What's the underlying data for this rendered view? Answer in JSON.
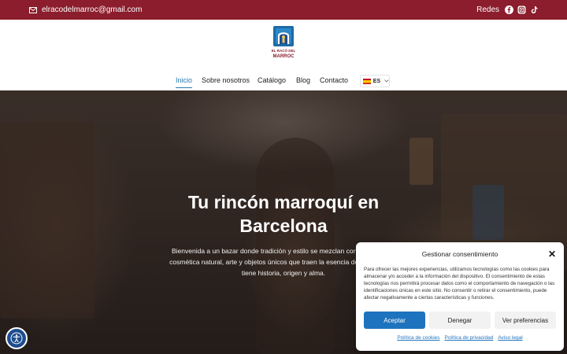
{
  "topbar": {
    "email": "elracodelmarroc@gmail.com",
    "social_label": "Redes",
    "icons": [
      "facebook-icon",
      "instagram-icon",
      "tiktok-icon"
    ],
    "bg_color": "#8b1d2c"
  },
  "header": {
    "logo_text_top": "EL RACÓ DEL",
    "logo_text_bottom": "MARROC",
    "nav": [
      {
        "label": "Inicio",
        "active": true
      },
      {
        "label": "Sobre nosotros",
        "active": false
      },
      {
        "label": "Catálogo",
        "active": false
      },
      {
        "label": "Blog",
        "active": false
      },
      {
        "label": "Contacto",
        "active": false
      }
    ],
    "language": "ES"
  },
  "hero": {
    "title_line1": "Tu rincón marroquí en",
    "title_line2": "Barcelona",
    "text_line1": "Bienvenida a un bazar donde tradición y estilo se mezclan con mucho color",
    "text_line2": "cosmética natural, arte y objetos únicos que traen la esencia de Marruecos a",
    "text_line3": "tiene historia, origen y alma."
  },
  "consent": {
    "title": "Gestionar consentimiento",
    "body": "Para ofrecer las mejores experiencias, utilizamos tecnologías como las cookies para almacenar y/o acceder a la información del dispositivo. El consentimiento de estas tecnologías nos permitirá procesar datos como el comportamiento de navegación o las identificaciones únicas en este sitio. No consentir o retirar el consentimiento, puede afectar negativamente a ciertas características y funciones.",
    "accept": "Aceptar",
    "deny": "Denegar",
    "preferences": "Ver preferencias",
    "links": [
      "Política de cookies",
      "Política de privacidad",
      "Aviso legal"
    ],
    "accent_color": "#1e73be"
  }
}
